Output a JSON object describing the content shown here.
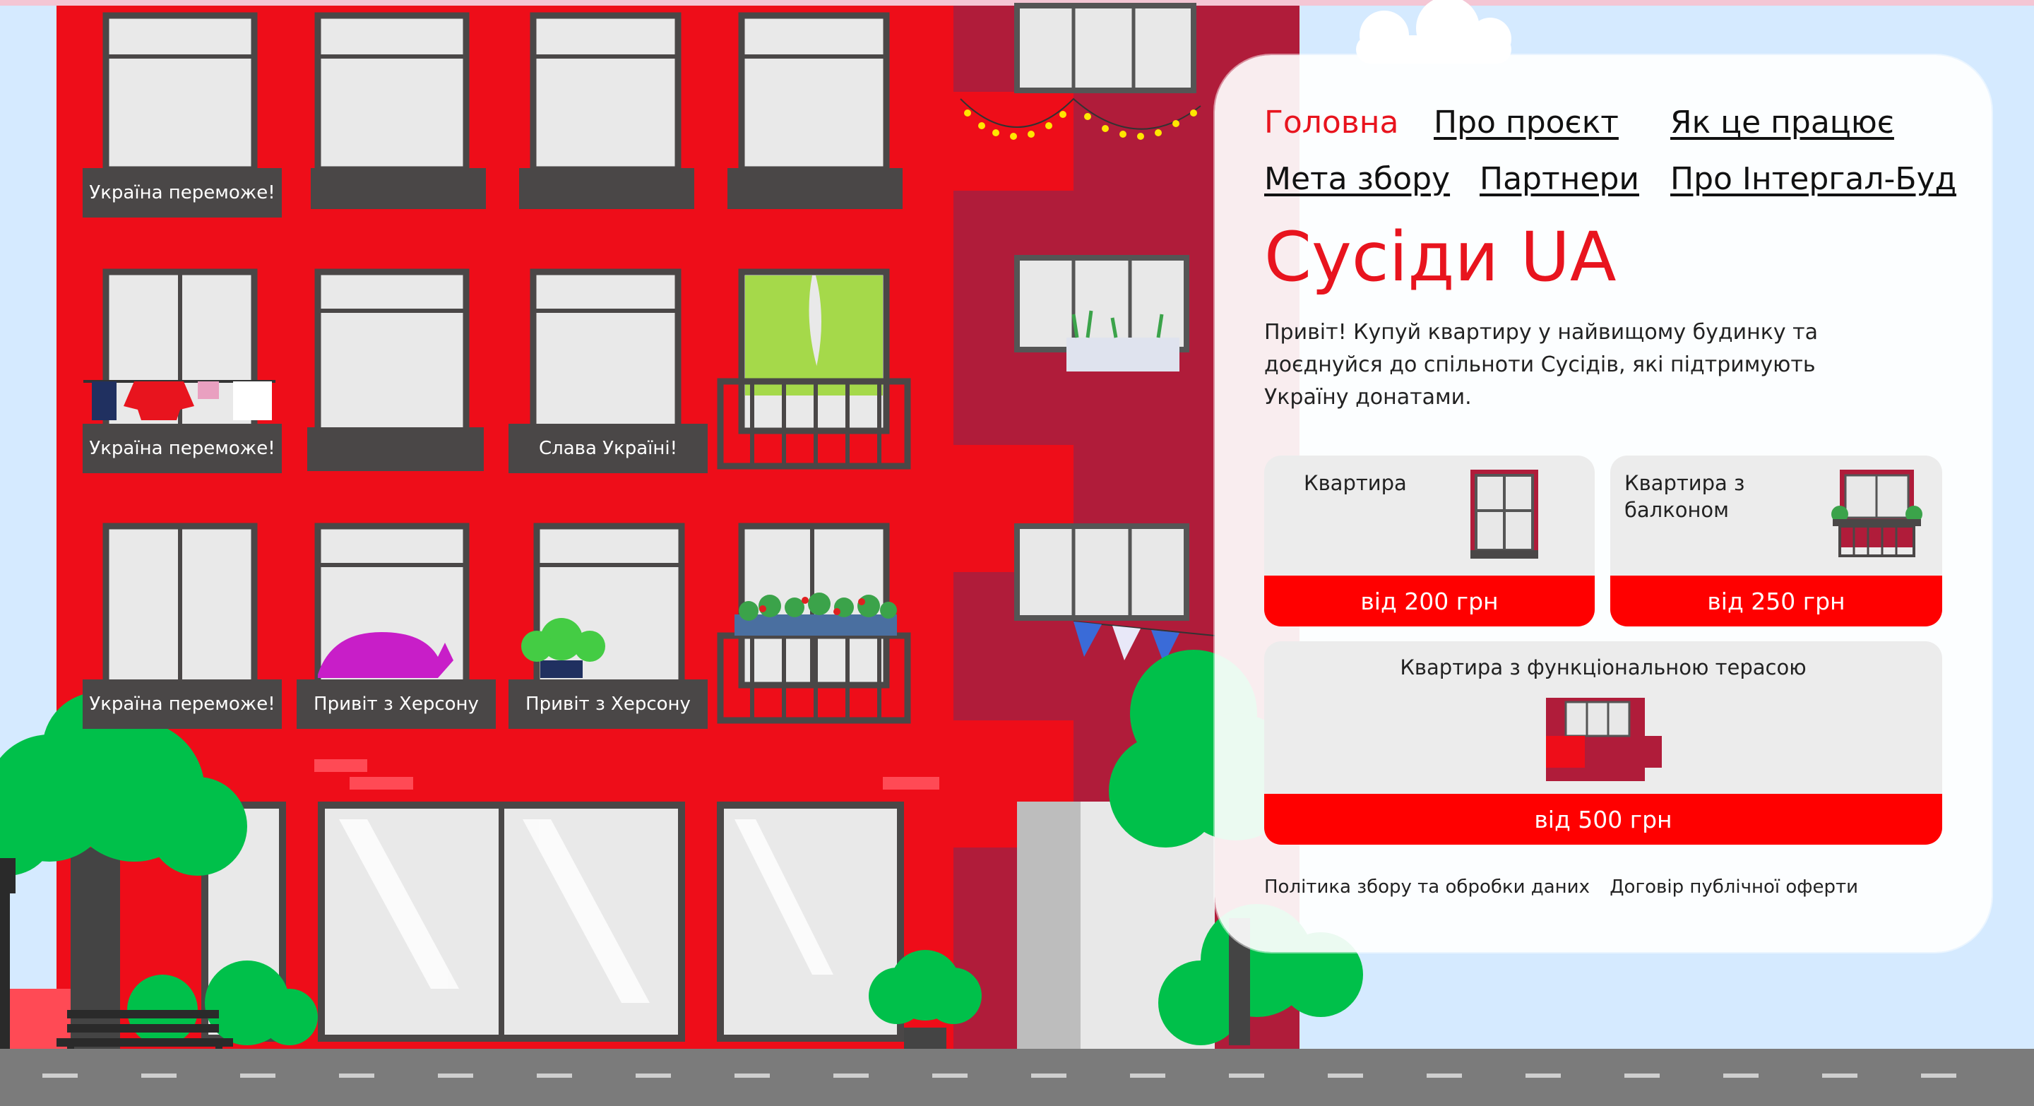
{
  "nav": {
    "home": "Головна",
    "about": "Про проєкт",
    "how": "Як це працює",
    "goal": "Мета збору",
    "partners": "Партнери",
    "integral": "Про Інтергал-Буд"
  },
  "hero": {
    "title": "Сусіди UA",
    "intro": "Привіт! Купуй квартиру у найвищому будинку та доєднуйся до спільноти Сусідів, які підтримують Україну донатами."
  },
  "cards": {
    "flat": {
      "label": "Квартира",
      "price": "від 200 грн"
    },
    "balcony": {
      "label": "Квартира з балконом",
      "price": "від 250 грн"
    },
    "terrace": {
      "label": "Квартира з функціональною терасою",
      "price": "від 500 грн"
    }
  },
  "footer_links": {
    "policy": "Політика збору та обробки даних",
    "offer": "Договір публічної оферти"
  },
  "window_signs": {
    "s1": "Україна переможе!",
    "s2": "Україна переможе!",
    "s3": "Слава Україні!",
    "s4": "Україна переможе!",
    "s5": "Привіт з Херсону",
    "s6": "Привіт з Херсону"
  },
  "colors": {
    "accent": "#e8141e",
    "building": "#ee0d19",
    "building_dark": "#b01c3a",
    "price_button": "#ff0000",
    "sky": "#d9ecff"
  },
  "icons": [
    "window-icon",
    "balcony-window-icon",
    "terrace-icon"
  ]
}
